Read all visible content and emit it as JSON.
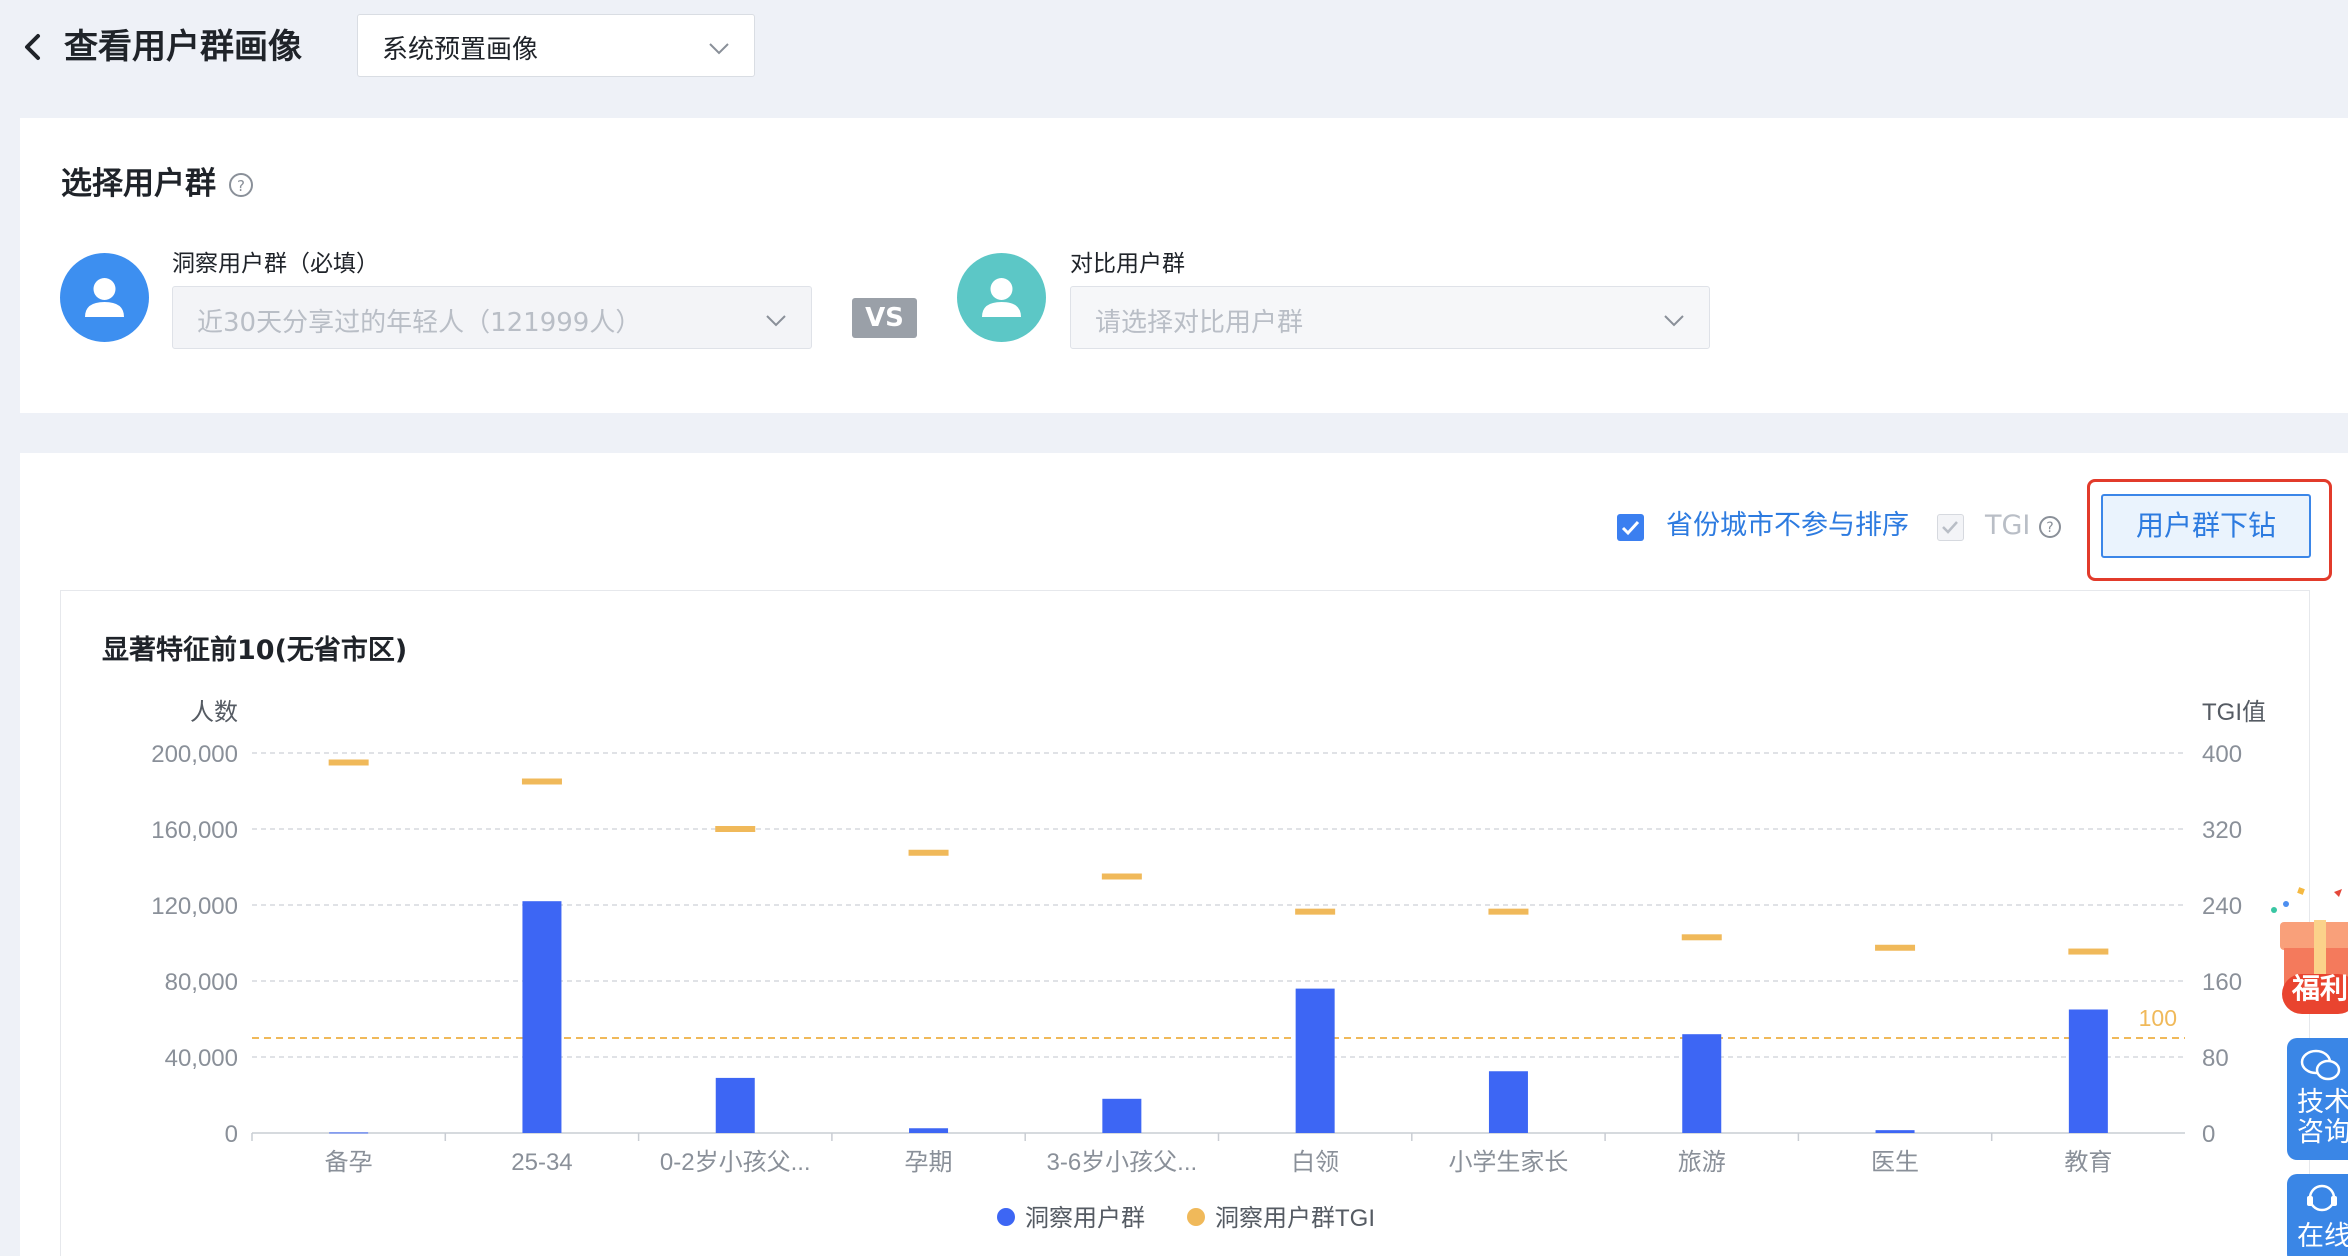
{
  "header": {
    "title": "查看用户群画像",
    "profile_select": "系统预置画像"
  },
  "select_group": {
    "title": "选择用户群",
    "insight_label": "洞察用户群（必填）",
    "insight_value": "近30天分享过的年轻人（121999人）",
    "vs": "VS",
    "compare_label": "对比用户群",
    "compare_placeholder": "请选择对比用户群"
  },
  "options": {
    "exclude_province": "省份城市不参与排序",
    "exclude_province_checked": true,
    "tgi": "TGI",
    "tgi_checked": true,
    "drill_button": "用户群下钻"
  },
  "floating": {
    "gift": "福利",
    "tech_line1": "技术",
    "tech_line2": "咨询",
    "online": "在线"
  },
  "colors": {
    "bar": "#3d66f4",
    "tgi": "#f0b95a",
    "accent": "#2d7be0",
    "highlight": "#e23b2b"
  },
  "chart_data": {
    "type": "bar",
    "title": "显著特征前10(无省市区)",
    "ylabel_left": "人数",
    "ylabel_right": "TGI值",
    "categories": [
      "备孕",
      "25-34",
      "0-2岁小孩父...",
      "孕期",
      "3-6岁小孩父...",
      "白领",
      "小学生家长",
      "旅游",
      "医生",
      "教育"
    ],
    "ylim_left": [
      0,
      200000
    ],
    "ylim_right": [
      0,
      400
    ],
    "yticks_left": [
      "0",
      "40,000",
      "80,000",
      "120,000",
      "160,000",
      "200,000"
    ],
    "yticks_right": [
      "0",
      "80",
      "160",
      "240",
      "320",
      "400"
    ],
    "reference_line": {
      "value": 100,
      "label": "100"
    },
    "series": [
      {
        "name": "洞察用户群",
        "kind": "bar",
        "axis": "left",
        "values": [
          300,
          122000,
          29000,
          2500,
          18000,
          76000,
          32500,
          52000,
          1500,
          65000
        ]
      },
      {
        "name": "洞察用户群TGI",
        "kind": "marker",
        "axis": "right",
        "values": [
          390,
          370,
          320,
          295,
          270,
          233,
          233,
          206,
          195,
          191
        ]
      }
    ],
    "grid": true,
    "legend_position": "bottom"
  }
}
